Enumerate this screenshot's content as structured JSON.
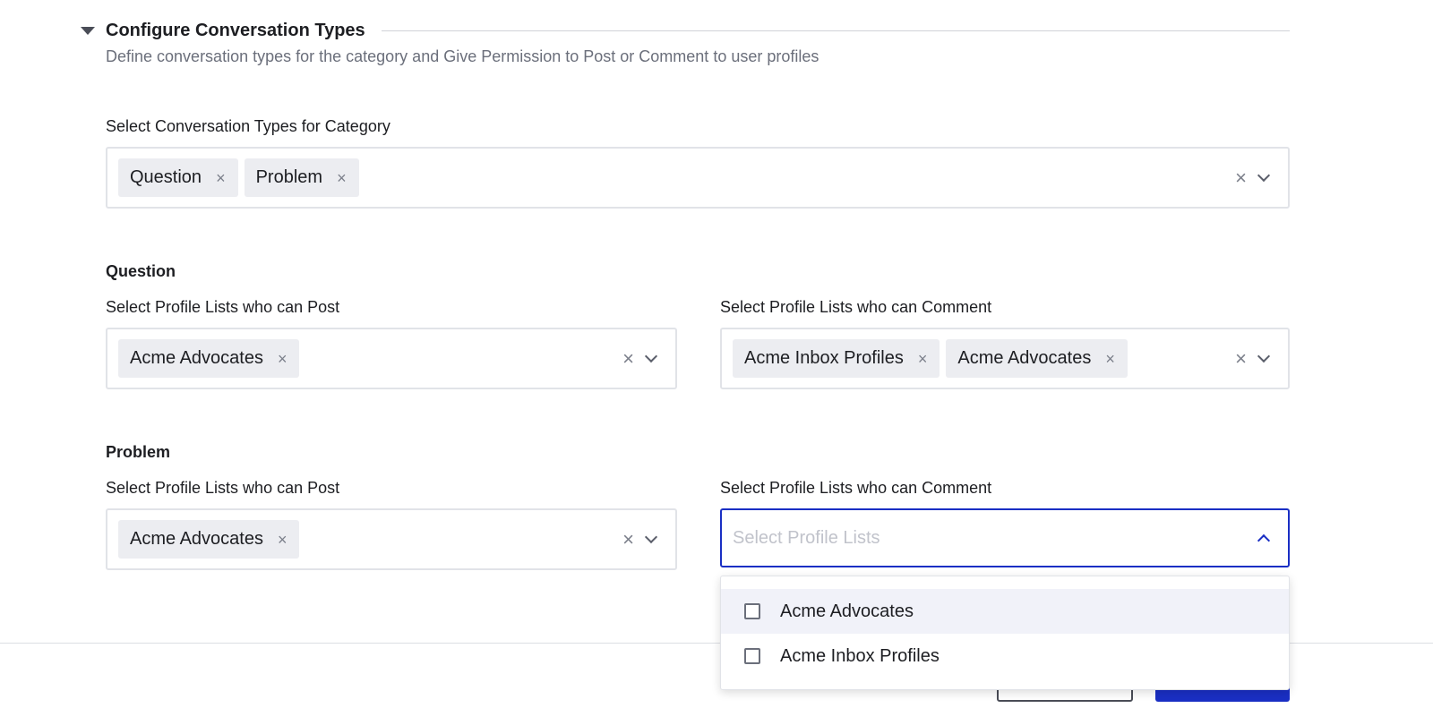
{
  "section": {
    "title": "Configure Conversation Types",
    "description": "Define conversation types for the category and Give Permission to Post or Comment to user profiles"
  },
  "conversation_types": {
    "label": "Select Conversation Types for Category",
    "selected": [
      "Question",
      "Problem"
    ]
  },
  "question": {
    "title": "Question",
    "post": {
      "label": "Select Profile Lists who can Post",
      "selected": [
        "Acme Advocates"
      ]
    },
    "comment": {
      "label": "Select Profile Lists who can Comment",
      "selected": [
        "Acme Inbox Profiles",
        "Acme Advocates"
      ]
    }
  },
  "problem": {
    "title": "Problem",
    "post": {
      "label": "Select Profile Lists who can Post",
      "selected": [
        "Acme Advocates"
      ]
    },
    "comment": {
      "label": "Select Profile Lists who can Comment",
      "placeholder": "Select Profile Lists"
    }
  },
  "dropdown": {
    "options": [
      "Acme Advocates",
      "Acme Inbox Profiles"
    ]
  },
  "icons": {
    "chip_remove": "×",
    "clear": "×"
  },
  "colors": {
    "accent": "#1a2fc4",
    "chip_bg": "#ecedf1",
    "border": "#e1e3e8"
  }
}
